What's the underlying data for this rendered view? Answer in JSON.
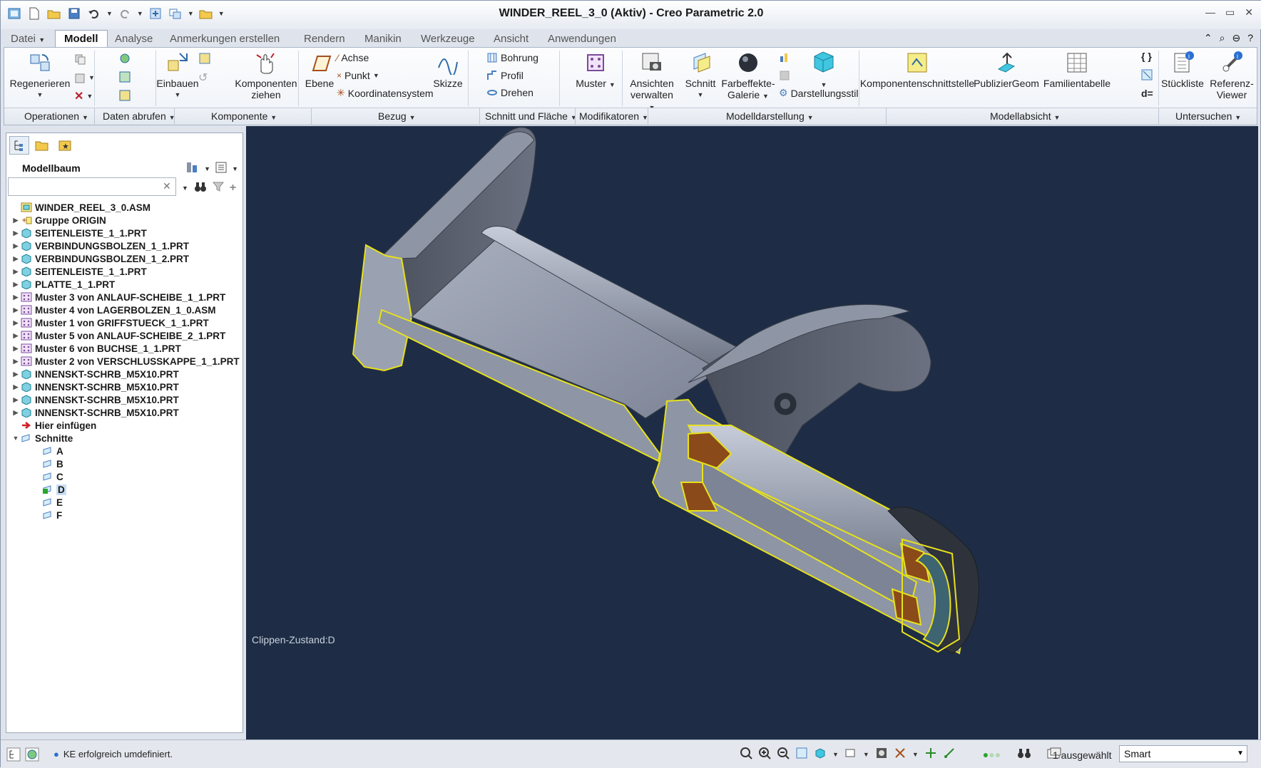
{
  "window": {
    "title": "WINDER_REEL_3_0 (Aktiv) - Creo Parametric 2.0"
  },
  "tabs": [
    "Datei",
    "Modell",
    "Analyse",
    "Anmerkungen erstellen",
    "Rendern",
    "Manikin",
    "Werkzeuge",
    "Ansicht",
    "Anwendungen"
  ],
  "ribbon": {
    "regenerieren": "Regenerieren",
    "einbauen": "Einbauen",
    "komponenten_ziehen": [
      "Komponenten",
      "ziehen"
    ],
    "ebene": "Ebene",
    "achse": "Achse",
    "punkt": "Punkt",
    "koordinatensystem": "Koordinatensystem",
    "skizze": "Skizze",
    "bohrung": "Bohrung",
    "profil": "Profil",
    "drehen": "Drehen",
    "muster": "Muster",
    "ansichten_verwalten": [
      "Ansichten",
      "verwalten"
    ],
    "schnitt": "Schnitt",
    "farbeffekte": [
      "Farbeffekte-",
      "Galerie"
    ],
    "darstellungsstil": "Darstellungsstil",
    "komponentenschnittstelle": "Komponentenschnittstelle",
    "publiziergeom": "PublizierGeom",
    "familientabelle": "Familientabelle",
    "stueckliste": "Stückliste",
    "referenz_viewer": [
      "Referenz-",
      "Viewer"
    ],
    "d_eq": "d="
  },
  "groups": [
    "Operationen",
    "Daten abrufen",
    "Komponente",
    "Bezug",
    "Schnitt und Fläche",
    "Modifikatoren",
    "Modelldarstellung",
    "Modellabsicht",
    "Untersuchen"
  ],
  "model_tree": {
    "title": "Modellbaum",
    "search_value": "",
    "items": [
      {
        "label": "WINDER_REEL_3_0.ASM",
        "type": "asm",
        "expander": "none",
        "indent": 0
      },
      {
        "label": "Gruppe ORIGIN",
        "type": "group",
        "expander": "closed",
        "indent": 0
      },
      {
        "label": "SEITENLEISTE_1_1.PRT",
        "type": "part",
        "expander": "closed",
        "indent": 0
      },
      {
        "label": "VERBINDUNGSBOLZEN_1_1.PRT",
        "type": "part",
        "expander": "closed",
        "indent": 0
      },
      {
        "label": "VERBINDUNGSBOLZEN_1_2.PRT",
        "type": "part",
        "expander": "closed",
        "indent": 0
      },
      {
        "label": "SEITENLEISTE_1_1.PRT",
        "type": "part",
        "expander": "closed",
        "indent": 0
      },
      {
        "label": "PLATTE_1_1.PRT",
        "type": "part",
        "expander": "closed",
        "indent": 0
      },
      {
        "label": "Muster 3 von ANLAUF-SCHEIBE_1_1.PRT",
        "type": "pattern",
        "expander": "closed",
        "indent": 0
      },
      {
        "label": "Muster 4 von LAGERBOLZEN_1_0.ASM",
        "type": "pattern",
        "expander": "closed",
        "indent": 0
      },
      {
        "label": "Muster 1 von GRIFFSTUECK_1_1.PRT",
        "type": "pattern",
        "expander": "closed",
        "indent": 0
      },
      {
        "label": "Muster 5 von ANLAUF-SCHEIBE_2_1.PRT",
        "type": "pattern",
        "expander": "closed",
        "indent": 0
      },
      {
        "label": "Muster 6 von BUCHSE_1_1.PRT",
        "type": "pattern",
        "expander": "closed",
        "indent": 0
      },
      {
        "label": "Muster 2 von VERSCHLUSSKAPPE_1_1.PRT",
        "type": "pattern",
        "expander": "closed",
        "indent": 0
      },
      {
        "label": "INNENSKT-SCHRB_M5X10.PRT",
        "type": "part",
        "expander": "closed",
        "indent": 0
      },
      {
        "label": "INNENSKT-SCHRB_M5X10.PRT",
        "type": "part",
        "expander": "closed",
        "indent": 0
      },
      {
        "label": "INNENSKT-SCHRB_M5X10.PRT",
        "type": "part",
        "expander": "closed",
        "indent": 0
      },
      {
        "label": "INNENSKT-SCHRB_M5X10.PRT",
        "type": "part",
        "expander": "closed",
        "indent": 0
      },
      {
        "label": "Hier einfügen",
        "type": "insert",
        "expander": "none",
        "indent": 0
      },
      {
        "label": "Schnitte",
        "type": "folder",
        "expander": "open",
        "indent": 0
      },
      {
        "label": "A",
        "type": "section",
        "expander": "none",
        "indent": 1
      },
      {
        "label": "B",
        "type": "section",
        "expander": "none",
        "indent": 1
      },
      {
        "label": "C",
        "type": "section",
        "expander": "none",
        "indent": 1
      },
      {
        "label": "D",
        "type": "section-active",
        "expander": "none",
        "indent": 1
      },
      {
        "label": "E",
        "type": "section",
        "expander": "none",
        "indent": 1
      },
      {
        "label": "F",
        "type": "section",
        "expander": "none",
        "indent": 1
      }
    ]
  },
  "viewport": {
    "clip_state": "Clippen-Zustand:D",
    "background": "#1e2d45",
    "highlight": "#f2ea1a"
  },
  "status": {
    "message": "KE erfolgreich umdefiniert.",
    "selection": "1 ausgewählt",
    "filter": "Smart"
  }
}
